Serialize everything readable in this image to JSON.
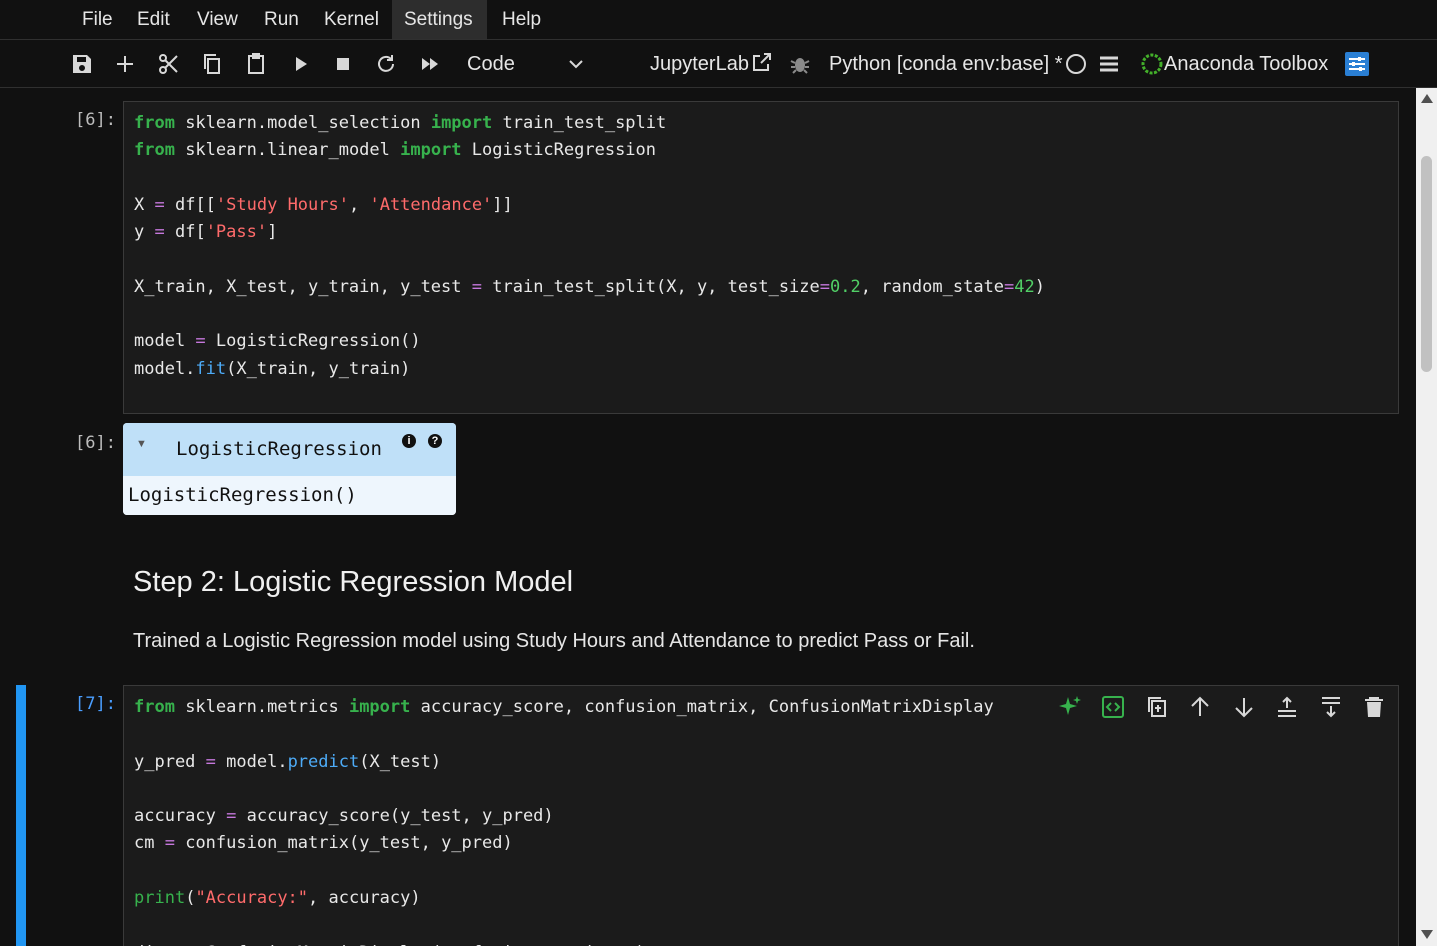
{
  "menu": {
    "file": "File",
    "edit": "Edit",
    "view": "View",
    "run": "Run",
    "kernel": "Kernel",
    "settings": "Settings",
    "help": "Help"
  },
  "toolbar": {
    "cell_type": "Code",
    "jupyterlab": "JupyterLab",
    "kernel_name": "Python [conda env:base] *",
    "anaconda": "Anaconda Toolbox"
  },
  "icons": {
    "save": "save-icon",
    "add": "plus-icon",
    "cut": "scissors-icon",
    "copy": "copy-icon",
    "paste": "paste-icon",
    "run": "play-icon",
    "stop": "stop-icon",
    "restart": "refresh-icon",
    "run_all": "fast-forward-icon",
    "external": "external-link-icon",
    "debug": "bug-icon",
    "kernel_status": "circle-icon",
    "menu": "hamburger-icon",
    "anaconda": "anaconda-ring-icon",
    "toolbox": "sliders-icon"
  },
  "cells": {
    "cell6": {
      "prompt": "[6]:",
      "output_prompt": "[6]:",
      "output_title": "LogisticRegression",
      "output_body": "LogisticRegression()",
      "info_icon": "i",
      "help_icon": "?"
    },
    "markdown": {
      "heading": "Step 2: Logistic Regression Model",
      "paragraph": "Trained a Logistic Regression model using Study Hours and Attendance to predict Pass or Fail."
    },
    "cell7": {
      "prompt": "[7]:"
    }
  },
  "colors": {
    "accent": "#2196f3",
    "keyword": "#37b24d",
    "string": "#ff6b6b",
    "function": "#4dabf7",
    "operator": "#c678dd",
    "background": "#111111"
  }
}
